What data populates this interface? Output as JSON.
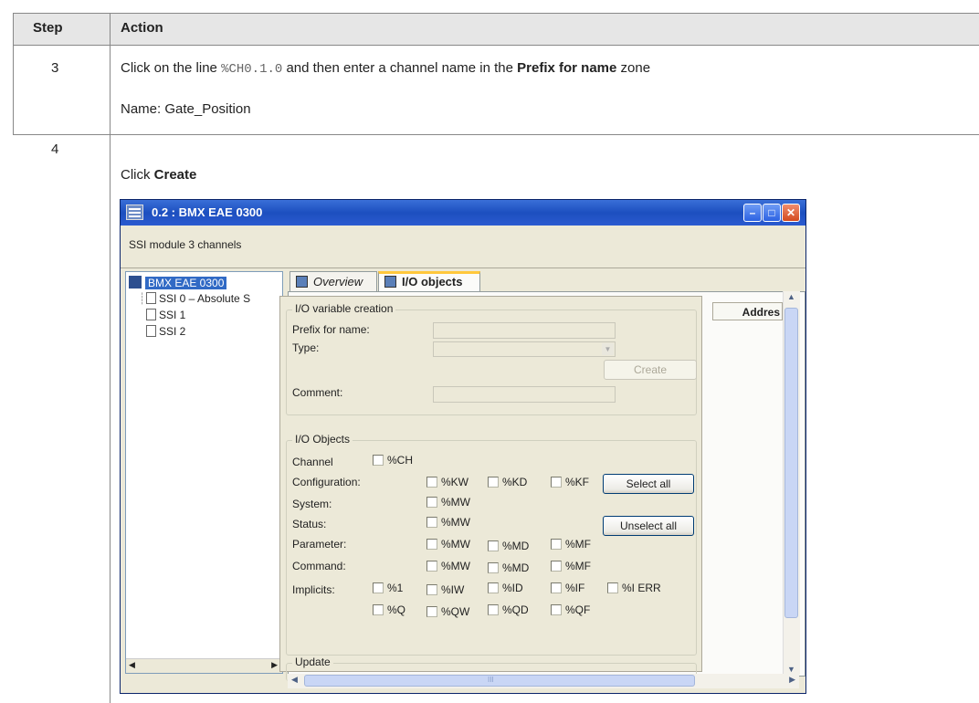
{
  "table": {
    "col_step": "Step",
    "col_action": "Action",
    "row3": {
      "step": "3",
      "line1_pre": "Click on the line ",
      "line1_code": "%CH0.1.0",
      "line1_mid": " and then enter a channel name in the ",
      "line1_bold": "Prefix for name",
      "line1_post": " zone",
      "line2": "Name: Gate_Position"
    },
    "row4": {
      "step": "4",
      "click": "Click ",
      "click_bold": "Create"
    }
  },
  "window": {
    "title": "0.2 : BMX  EAE 0300",
    "subtitle": "SSI module 3 channels",
    "min_label": "–",
    "max_label": "□",
    "close_label": "✕",
    "tree": [
      {
        "label": "BMX EAE 0300",
        "selected": true
      },
      {
        "label": "SSI 0 – Absolute S"
      },
      {
        "label": "SSI 1"
      },
      {
        "label": "SSI 2"
      }
    ],
    "tabs": [
      {
        "label": "Overview"
      },
      {
        "label": "I/O objects",
        "active": true
      }
    ],
    "creation": {
      "legend": "I/O variable creation",
      "prefix_label": "Prefix for name:",
      "type_label": "Type:",
      "create_button": "Create",
      "comment_label": "Comment:"
    },
    "objects": {
      "legend": "I/O Objects",
      "channel_label": "Channel",
      "channel_cb": "%CH",
      "configuration_label": "Configuration:",
      "config_cbs": [
        "%KW",
        "%KD",
        "%KF"
      ],
      "select_all": "Select all",
      "system_label": "System:",
      "system_cb": "%MW",
      "status_label": "Status:",
      "status_cb": "%MW",
      "unselect_all": "Unselect all",
      "parameter_label": "Parameter:",
      "parameter_cbs": [
        "%MW",
        "%MD",
        "%MF"
      ],
      "command_label": "Command:",
      "command_cbs": [
        "%MW",
        "%MD",
        "%MF"
      ],
      "implicits_label": "Implicits:",
      "implicit_row1": [
        "%1",
        "%IW",
        "%ID",
        "%IF",
        "%I ERR"
      ],
      "implicit_row2": [
        "%Q",
        "%QW",
        "%QD",
        "%QF"
      ]
    },
    "update_legend": "Update",
    "address_header": "Addres",
    "hscroll_grip": "III"
  }
}
